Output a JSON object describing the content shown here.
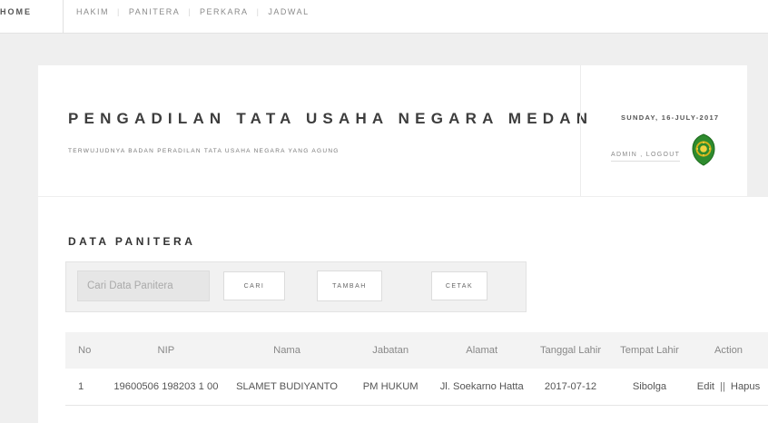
{
  "nav": {
    "home": "HOME",
    "items": [
      "HAKIM",
      "PANITERA",
      "PERKARA",
      "JADWAL"
    ]
  },
  "header": {
    "title": "PENGADILAN TATA USAHA NEGARA MEDAN",
    "subtitle": "TERWUJUDNYA BADAN PERADILAN TATA USAHA NEGARA YANG AGUNG",
    "date": "SUNDAY, 16-JULY-2017",
    "admin_link": "ADMIN , LOGOUT"
  },
  "section": {
    "title": "DATA PANITERA"
  },
  "toolbar": {
    "search_placeholder": "Cari Data Panitera",
    "cari_label": "CARI",
    "tambah_label": "TAMBAH",
    "cetak_label": "CETAK"
  },
  "table": {
    "headers": [
      "No",
      "NIP",
      "Nama",
      "Jabatan",
      "Alamat",
      "Tanggal Lahir",
      "Tempat Lahir",
      "Action"
    ],
    "rows": [
      {
        "no": "1",
        "nip": "19600506 198203 1 00",
        "nama": "SLAMET BUDIYANTO",
        "jabatan": "PM HUKUM",
        "alamat": "Jl. Soekarno Hatta",
        "tanggal_lahir": "2017-07-12",
        "tempat_lahir": "Sibolga",
        "edit": "Edit",
        "sep": "||",
        "hapus": "Hapus"
      }
    ]
  },
  "colors": {
    "background": "#efefef",
    "card": "#ffffff",
    "logo_green": "#2e8b2e",
    "logo_gold": "#d4b21a"
  },
  "icons": {
    "logo": "court-emblem-icon"
  }
}
